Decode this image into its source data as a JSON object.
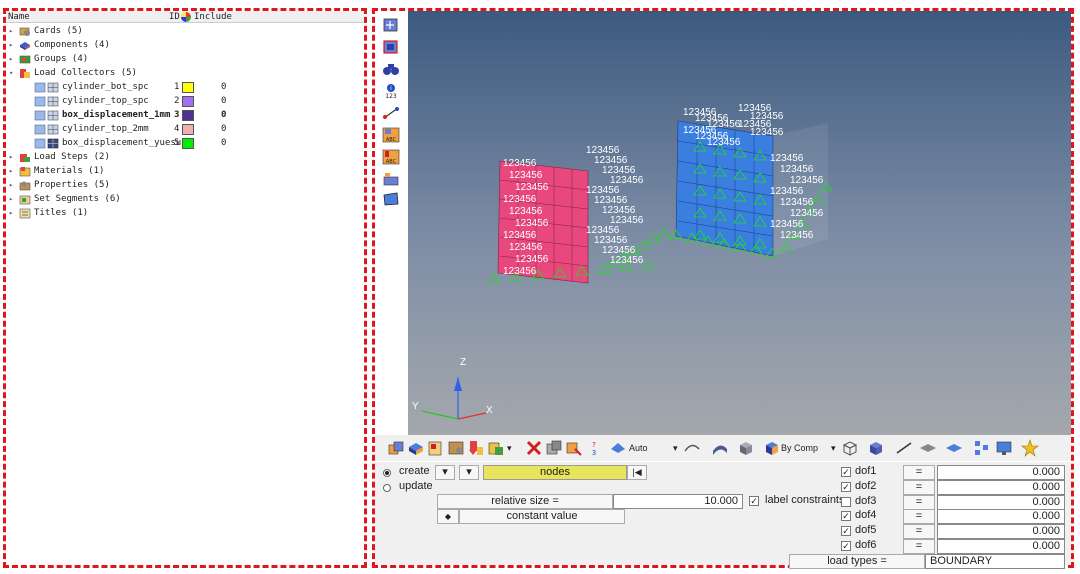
{
  "browser": {
    "columns": {
      "name": "Name",
      "id": "ID",
      "include": "Include"
    },
    "rows": [
      {
        "label": "Cards (5)",
        "icon": "cards-icon"
      },
      {
        "label": "Components (4)",
        "icon": "components-icon"
      },
      {
        "label": "Groups (4)",
        "icon": "groups-icon"
      },
      {
        "label": "Load Collectors (5)",
        "icon": "load-collectors-icon"
      },
      {
        "label": "cylinder_bot_spc",
        "id": "1",
        "color": "#ffff00",
        "include": "0"
      },
      {
        "label": "cylinder_top_spc",
        "id": "2",
        "color": "#a070f0",
        "include": "0"
      },
      {
        "label": "box_displacement_1mm",
        "id": "3",
        "color": "#503090",
        "include": "0"
      },
      {
        "label": "cylinder_top_2mm",
        "id": "4",
        "color": "#f0b0b0",
        "include": "0"
      },
      {
        "label": "box_displacement_yuesu",
        "id": "5",
        "color": "#00ee00",
        "include": "0"
      },
      {
        "label": "Load Steps (2)",
        "icon": "load-steps-icon"
      },
      {
        "label": "Materials (1)",
        "icon": "materials-icon"
      },
      {
        "label": "Properties (5)",
        "icon": "properties-icon"
      },
      {
        "label": "Set Segments (6)",
        "icon": "set-segments-icon"
      },
      {
        "label": "Titles (1)",
        "icon": "titles-icon"
      }
    ]
  },
  "viewport": {
    "axis_z": "Z",
    "axis_y": "Y",
    "axis_x": "X",
    "dof_label": "123456",
    "box_left_color": "#e8487e",
    "box_right_color": "#3a7fe0",
    "constraint_color": "#22dd22"
  },
  "toolbar": {
    "auto_label": "Auto",
    "bycomp_label": "By Comp"
  },
  "form": {
    "create_label": "create",
    "update_label": "update",
    "nodes_label": "nodes",
    "relative_size_label": "relative size =",
    "relative_size_value": "10.000",
    "label_constraints": "label constraints",
    "constant_value_label": "constant value",
    "load_types_label": "load types =",
    "load_types_value": "BOUNDARY",
    "dofs": [
      {
        "name": "dof1",
        "checked": true,
        "value": "0.000"
      },
      {
        "name": "dof2",
        "checked": true,
        "value": "0.000"
      },
      {
        "name": "dof3",
        "checked": false,
        "value": "0.000"
      },
      {
        "name": "dof4",
        "checked": true,
        "value": "0.000"
      },
      {
        "name": "dof5",
        "checked": true,
        "value": "0.000"
      },
      {
        "name": "dof6",
        "checked": true,
        "value": "0.000"
      }
    ],
    "equals": "="
  }
}
